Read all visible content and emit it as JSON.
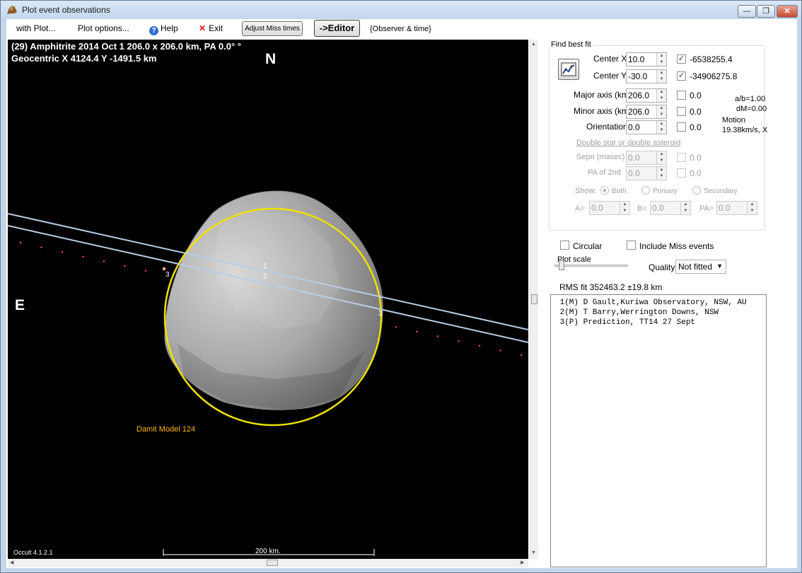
{
  "window": {
    "title": "Plot event observations",
    "minimize_glyph": "—",
    "restore_glyph": "❐",
    "close_glyph": "✕"
  },
  "menu": {
    "with_plot": "with Plot...",
    "plot_options": "Plot options...",
    "help": "Help",
    "exit": "Exit",
    "adjust_miss": "Adjust Miss times",
    "editor": "->Editor",
    "observer_time": "{Observer & time}"
  },
  "plot": {
    "header_line1": "(29) Amphitrite  2014 Oct 1   206.0 x 206.0 km, PA 0.0° °",
    "header_line2": "Geocentric  X 4124.4  Y -1491.5 km",
    "north_label": "N",
    "east_label": "E",
    "model_label": "Damit Model 124",
    "version_label": "Occult 4.1.2.1",
    "scale_label": "200 km.",
    "chord_label_1": "1",
    "chord_label_2": "2",
    "prediction_label_left": "3",
    "prediction_label_right": "3",
    "ellipse_color": "#f0e000",
    "chord_color": "#b8cde6",
    "prediction_dot_color": "#ff4f6a",
    "model_label_color": "#ffb400"
  },
  "fit": {
    "group_label": "Find best fit",
    "center_x_label": "Center X",
    "center_x": "10.0",
    "center_x_checked": true,
    "center_x_value": "-6538255.4",
    "center_y_label": "Center Y",
    "center_y": "-30.0",
    "center_y_checked": true,
    "center_y_value": "-34906275.8",
    "major_label": "Major axis (km)",
    "major": "206.0",
    "major_value": "0.0",
    "minor_label": "Minor axis (km)",
    "minor": "206.0",
    "minor_value": "0.0",
    "orient_label": "Orientation",
    "orient": "0.0",
    "orient_value": "0.0",
    "ab_text": "a/b=1.00",
    "dm_text": "dM=0.00",
    "motion_label": "Motion",
    "motion_value": "19.38km/s, X",
    "double_label": "Double star  or  double asteroid",
    "sepn_label": "Sepn (masec)",
    "sepn": "0.0",
    "sepn_value": "0.0",
    "pa2_label": "PA of 2nd",
    "pa2": "0.0",
    "pa2_value": "0.0",
    "show_label": "Show:",
    "show_both": "Both",
    "show_primary": "Primary",
    "show_secondary": "Secondary",
    "a_label": "A=",
    "a_value": "0.0",
    "b_label": "B=",
    "b_value": "0.0",
    "pa_label": "PA=",
    "pa_value": "0.0"
  },
  "options": {
    "circular_label": "Circular",
    "include_miss_label": "Include Miss events",
    "plot_scale_label": "Plot scale",
    "quality_label": "Quality",
    "quality_value": "Not fitted"
  },
  "rms_text": "RMS fit 352463.2 ±19.8 km",
  "observations": [
    " 1(M) D Gault,Kuriwa Observatory, NSW, AU",
    " 2(M) T Barry,Werrington Downs, NSW",
    " 3(P) Prediction, TT14 27 Sept"
  ]
}
